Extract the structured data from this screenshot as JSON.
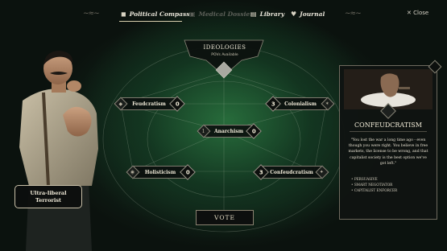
{
  "topbar": {
    "tabs": [
      {
        "label": "Political Compass",
        "icon": "compass-icon",
        "state": "active"
      },
      {
        "label": "Medical Dossier",
        "icon": "dossier-icon",
        "state": "disabled"
      },
      {
        "label": "Library",
        "icon": "book-icon",
        "state": "normal"
      },
      {
        "label": "Journal",
        "icon": "heart-journal-icon",
        "state": "normal"
      }
    ],
    "close_label": "Close"
  },
  "ideologies": {
    "title": "IDEOLOGIES",
    "subtitle": "POVs Available"
  },
  "nodes": {
    "feudcratism": {
      "label": "Feudcratism",
      "value": "0"
    },
    "colonialism": {
      "label": "Colonialism",
      "value": "3"
    },
    "anarchism": {
      "label": "Anarchism",
      "value": "0",
      "left_value": "1"
    },
    "holisticism": {
      "label": "Holisticism",
      "value": "0"
    },
    "confeudcratism": {
      "label": "Confeudcratism",
      "value": "3"
    }
  },
  "vote_label": "VOTE",
  "character_label": {
    "line1": "Ultra-liberal",
    "line2": "Terrorist"
  },
  "card": {
    "title": "CONFEUDCRATISM",
    "quote": "\"You lost the war a long time ago - even though you were right. You believe in free markets, the license to be wrong, and that capitalist society is the best option we've got left.\"",
    "traits": [
      "PERSUASIVE",
      "SMART NEGOTIATOR",
      "CAPITALIST ENFORCER"
    ]
  },
  "colors": {
    "accent_green": "#2a6b3c",
    "plate_border": "#7d7a6e",
    "text_light": "#f0ead8"
  }
}
